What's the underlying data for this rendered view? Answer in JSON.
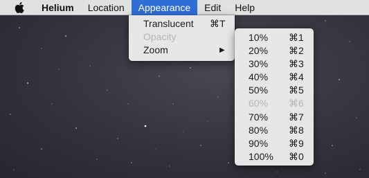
{
  "menubar": {
    "apple_icon": "apple-logo-icon",
    "items": [
      {
        "label": "Helium"
      },
      {
        "label": "Location"
      },
      {
        "label": "Appearance"
      },
      {
        "label": "Edit"
      },
      {
        "label": "Help"
      }
    ]
  },
  "appearance_menu": {
    "items": [
      {
        "label": "Translucent",
        "shortcut": "⌘T",
        "enabled": true
      },
      {
        "label": "Opacity",
        "shortcut": "",
        "enabled": false
      },
      {
        "label": "Zoom",
        "submenu_arrow": "▶",
        "enabled": true
      }
    ]
  },
  "zoom_submenu": {
    "items": [
      {
        "label": "10%",
        "shortcut": "⌘1",
        "enabled": true
      },
      {
        "label": "20%",
        "shortcut": "⌘2",
        "enabled": true
      },
      {
        "label": "30%",
        "shortcut": "⌘3",
        "enabled": true
      },
      {
        "label": "40%",
        "shortcut": "⌘4",
        "enabled": true
      },
      {
        "label": "50%",
        "shortcut": "⌘5",
        "enabled": true
      },
      {
        "label": "60%",
        "shortcut": "⌘6",
        "enabled": false
      },
      {
        "label": "70%",
        "shortcut": "⌘7",
        "enabled": true
      },
      {
        "label": "80%",
        "shortcut": "⌘8",
        "enabled": true
      },
      {
        "label": "90%",
        "shortcut": "⌘9",
        "enabled": true
      },
      {
        "label": "100%",
        "shortcut": "⌘0",
        "enabled": true
      }
    ]
  },
  "colors": {
    "menubar_bg": "#e8e8e8",
    "active_menu_bg": "#2f6ed6",
    "disabled_text": "#b4b4b4"
  }
}
